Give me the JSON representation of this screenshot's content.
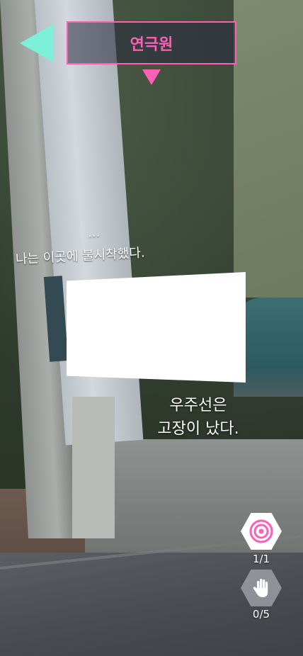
{
  "header": {
    "title": "연극원"
  },
  "dialogue": {
    "ellipsis": "...",
    "line1": "나는 이곳에 불시착했다.",
    "line2a": "우주선은",
    "line2b": "고장이 났다."
  },
  "counters": {
    "target_icon": "target-icon",
    "target_count": "1/1",
    "hand_icon": "hand-icon",
    "hand_count": "0/5"
  },
  "colors": {
    "accent_pink": "#ff5fb8",
    "accent_mint": "#7ff0d8"
  }
}
